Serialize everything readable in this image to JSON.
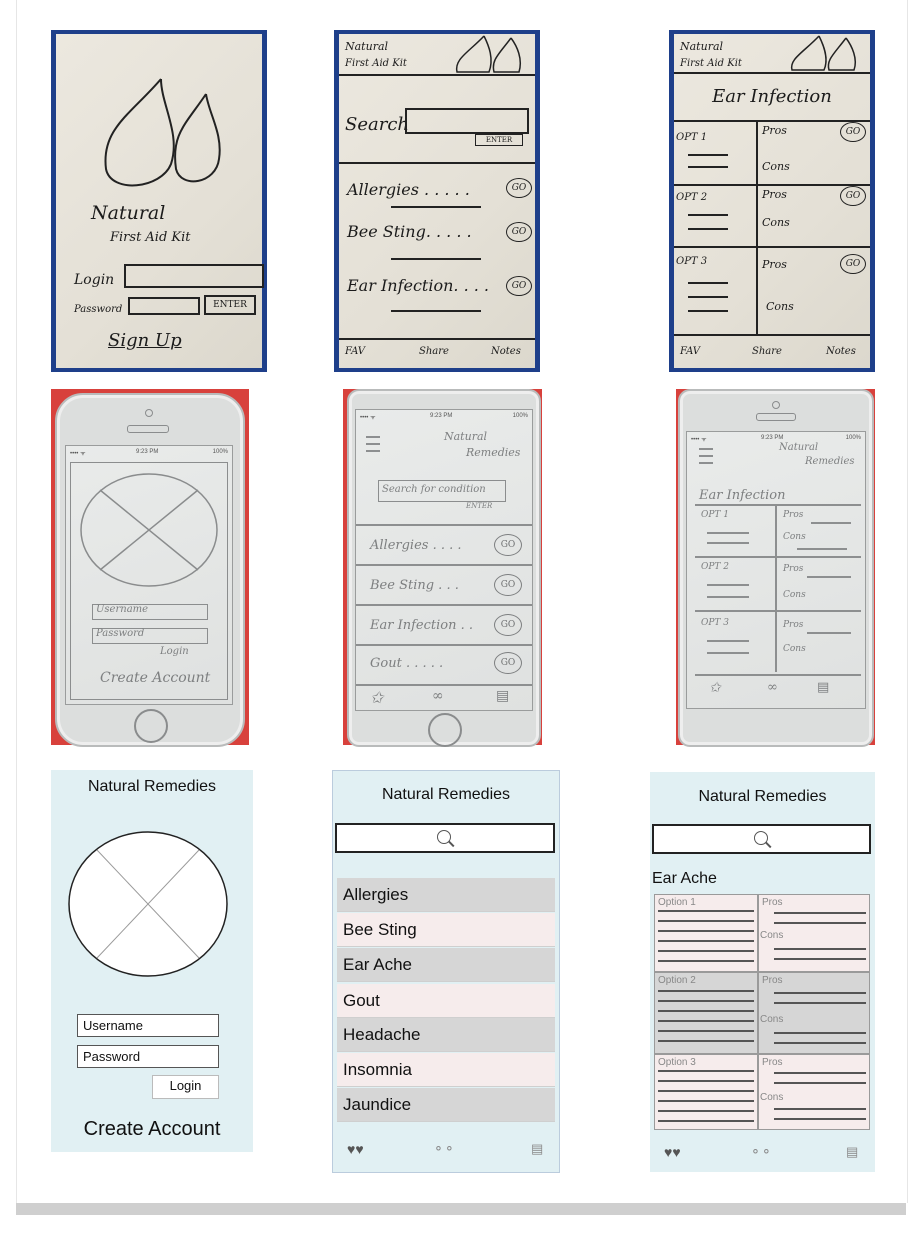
{
  "row1": {
    "login": {
      "brand_line1": "Natural",
      "brand_line2": "First Aid Kit",
      "login_label": "Login",
      "password_label": "Password",
      "enter_label": "ENTER",
      "signup_label": "Sign Up"
    },
    "list": {
      "header_line1": "Natural",
      "header_line2": "First Aid Kit",
      "search_label": "Search",
      "enter_label": "ENTER",
      "items": [
        "Allergies . . . . .",
        "Bee Sting. . . . .",
        "Ear Infection. . . ."
      ],
      "go_label": "GO",
      "footer": [
        "FAV",
        "Share",
        "Notes"
      ]
    },
    "detail": {
      "header_line1": "Natural",
      "header_line2": "First Aid Kit",
      "title": "Ear Infection",
      "options": [
        "OPT 1",
        "OPT 2",
        "OPT 3"
      ],
      "pros_label": "Pros",
      "cons_label": "Cons",
      "go_label": "GO",
      "footer": [
        "FAV",
        "Share",
        "Notes"
      ]
    }
  },
  "row2": {
    "login": {
      "time": "9:23 PM",
      "battery": "100%",
      "username_label": "Username",
      "password_label": "Password",
      "login_label": "Login",
      "create_label": "Create Account"
    },
    "list": {
      "time": "9:23 PM",
      "battery": "100%",
      "header_line1": "Natural",
      "header_line2": "Remedies",
      "search_placeholder": "Search for condition",
      "enter_label": "ENTER",
      "items": [
        "Allergies . . . .",
        "Bee Sting . . .",
        "Ear Infection . .",
        "Gout . . . . ."
      ],
      "go_label": "GO"
    },
    "detail": {
      "time": "9:23 PM",
      "battery": "100%",
      "header_line1": "Natural",
      "header_line2": "Remedies",
      "title": "Ear Infection",
      "options": [
        "OPT 1",
        "OPT 2",
        "OPT 3"
      ],
      "pros_label": "Pros",
      "cons_label": "Cons"
    }
  },
  "row3": {
    "login": {
      "title": "Natural Remedies",
      "username": "Username",
      "password": "Password",
      "login_button": "Login",
      "create_account": "Create Account"
    },
    "list": {
      "title": "Natural Remedies",
      "items": [
        "Allergies",
        "Bee Sting",
        "Ear Ache",
        "Gout",
        "Headache",
        "Insomnia",
        "Jaundice"
      ]
    },
    "detail": {
      "title": "Natural Remedies",
      "subtitle": "Ear Ache",
      "options": [
        "Option 1",
        "Option 2",
        "Option 3"
      ],
      "pros_label": "Pros",
      "cons_label": "Cons"
    },
    "tab_icons": [
      "hearts-icon",
      "chat-icon",
      "notes-icon"
    ]
  },
  "colors": {
    "paper_bg": "#1e3f8a",
    "red_bg": "#d8413c",
    "mock_bg": "#e1f0f3",
    "row_dark": "#d6d6d6",
    "row_light": "#f6ecec"
  }
}
